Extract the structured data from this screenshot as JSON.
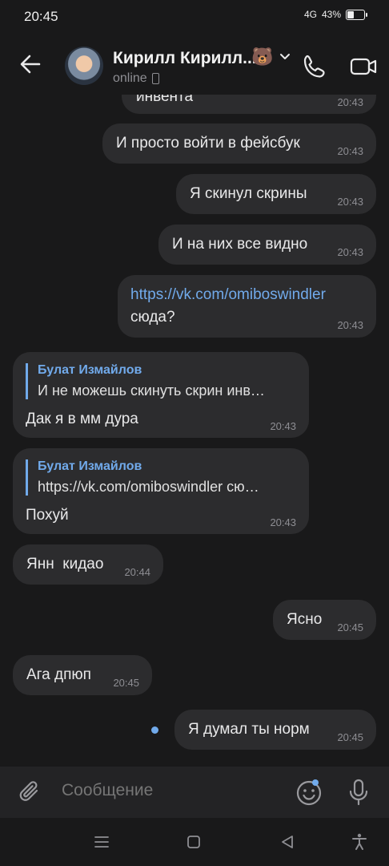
{
  "status": {
    "time": "20:45",
    "signal": "4G",
    "battery": "43%",
    "battery_level": 0.43
  },
  "header": {
    "title": "Кирилл Кирилл...",
    "sticker": "🐻",
    "status": "online"
  },
  "messages": [
    {
      "side": "out",
      "text": "инвента",
      "time": "20:43"
    },
    {
      "side": "out",
      "text": "И просто войти в фейсбук",
      "time": "20:43"
    },
    {
      "side": "out",
      "text": "Я скинул скрины",
      "time": "20:43"
    },
    {
      "side": "out",
      "text": "И на них все видно",
      "time": "20:43"
    },
    {
      "side": "out",
      "link": "https://vk.com/omiboswindler",
      "text": "сюда?",
      "time": "20:43"
    },
    {
      "side": "in",
      "reply_author": "Булат Измайлов",
      "reply_text": "И не можешь скинуть скрин инв…",
      "text": "Дак я в мм дура",
      "time": "20:43"
    },
    {
      "side": "in",
      "reply_author": "Булат Измайлов",
      "reply_text": "https://vk.com/omiboswindler сю…",
      "text": "Похуй",
      "time": "20:43"
    },
    {
      "side": "in",
      "text": "Янн  кидао",
      "time": "20:44"
    },
    {
      "side": "out",
      "text": "Ясно",
      "time": "20:45"
    },
    {
      "side": "in",
      "text": "Ага дпюп",
      "time": "20:45"
    },
    {
      "side": "out",
      "text": "Я думал ты норм",
      "time": "20:45",
      "unread": true
    }
  ],
  "composer": {
    "placeholder": "Сообщение"
  },
  "icons": {
    "back": "arrow-left-icon",
    "call": "phone-icon",
    "video": "video-camera-icon",
    "attach": "paperclip-icon",
    "emoji": "smiley-icon",
    "mic": "microphone-icon"
  },
  "colors": {
    "background": "#19191a",
    "bubble": "#2c2c2e",
    "accent": "#71aaeb"
  }
}
